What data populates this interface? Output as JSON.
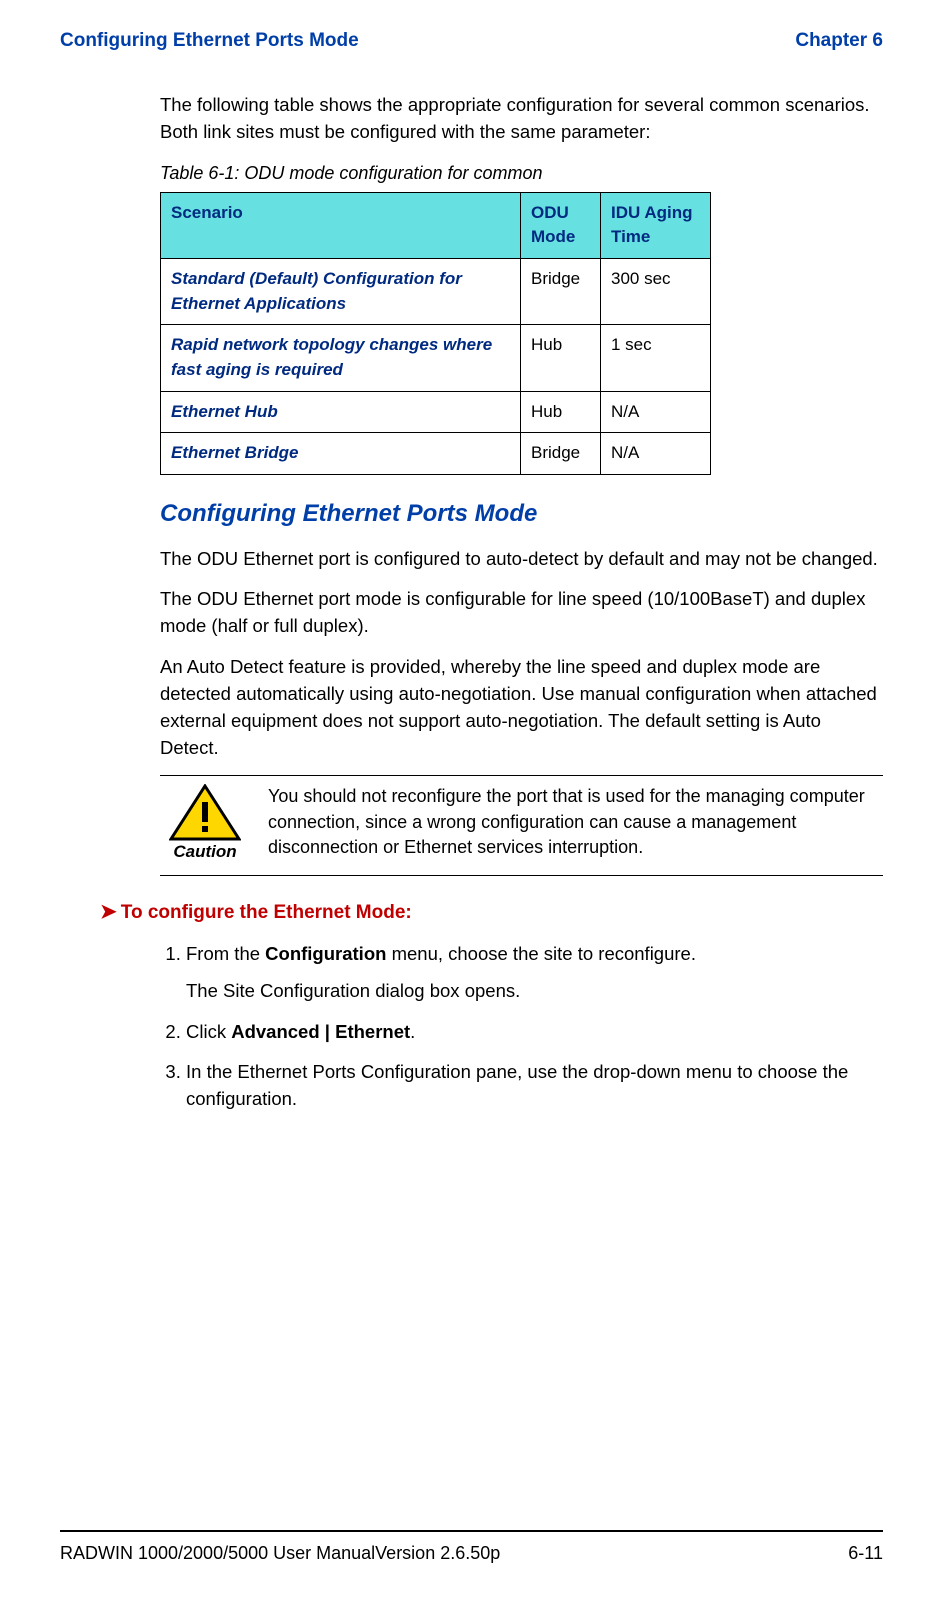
{
  "header": {
    "left": "Configuring Ethernet Ports Mode",
    "right": "Chapter 6"
  },
  "intro_para": "The following table shows the appropriate configuration for several common scenarios. Both link sites must be configured with the same parameter:",
  "table": {
    "caption": "Table 6-1: ODU mode configuration for common",
    "head": {
      "c1": "Scenario",
      "c2": "ODU Mode",
      "c3": "IDU Aging Time"
    },
    "rows": [
      {
        "scenario": "Standard (Default) Configuration for Ethernet Applications",
        "mode": "Bridge",
        "aging": "300 sec"
      },
      {
        "scenario": "Rapid network topology changes where fast aging is required",
        "mode": "Hub",
        "aging": "1 sec"
      },
      {
        "scenario": "Ethernet Hub",
        "mode": "Hub",
        "aging": "N/A"
      },
      {
        "scenario": "Ethernet Bridge",
        "mode": "Bridge",
        "aging": "N/A"
      }
    ]
  },
  "section_title": "Configuring Ethernet Ports Mode",
  "p1": "The ODU Ethernet port is configured to auto-detect by default and may not be changed.",
  "p2": "The ODU Ethernet port mode is configurable for line speed (10/100BaseT) and duplex mode (half or full duplex).",
  "p3": "An Auto Detect feature is provided, whereby the line speed and duplex mode are detected automatically using auto-negotiation. Use manual configuration when attached external equipment does not support auto-negotiation. The default setting is Auto Detect.",
  "caution": {
    "label": "Caution",
    "text": "You should not reconfigure the port that is used for the managing computer connection, since a wrong configuration can cause a management disconnection or Ethernet services interruption."
  },
  "task_title": "To configure the Ethernet Mode:",
  "steps": {
    "s1a": "From the ",
    "s1b": "Configuration",
    "s1c": " menu, choose the site to reconfigure.",
    "s1_sub": "The Site Configuration dialog box opens.",
    "s2a": "Click ",
    "s2b": "Advanced | Ethernet",
    "s2c": ".",
    "s3": "In the Ethernet Ports Configuration pane, use the drop-down menu to choose the configuration."
  },
  "footer": {
    "left": "RADWIN 1000/2000/5000 User ManualVersion  2.6.50p",
    "right": "6-11"
  }
}
